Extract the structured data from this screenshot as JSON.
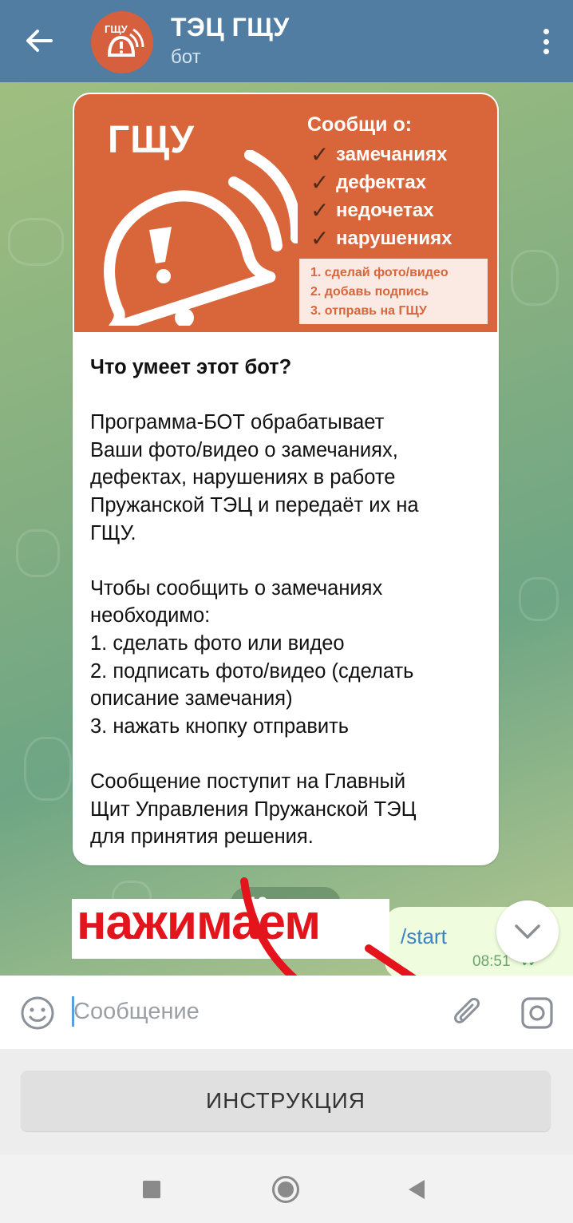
{
  "header": {
    "title": "ТЭЦ ГЩУ",
    "subtitle": "бот",
    "back_icon": "arrow-left-icon",
    "menu_icon": "more-vertical-icon",
    "avatar_text": "ГЩУ"
  },
  "banner": {
    "brand": "ГЩУ",
    "heading": "Сообщи о:",
    "items": [
      "замечаниях",
      "дефектах",
      "недочетах",
      "нарушениях"
    ],
    "steps": [
      "1. сделай фото/видео",
      "2. добавь подпись",
      "3. отправь на ГЩУ"
    ]
  },
  "message": {
    "title": "Что умеет этот бот?",
    "body": "Программа-БОТ обрабатывает\nВаши фото/видео о замечаниях,\nдефектах, нарушениях в работе\nПружанской ТЭЦ и передаёт их на\nГЩУ.\n\nЧтобы сообщить о замечаниях\nнеобходимо:\n1. сделать фото или видео\n2. подписать фото/видео (сделать\nописание замечания)\n3. нажать кнопку отправить\n\nСообщение поступит на Главный\nЩит Управления Пружанской ТЭЦ\nдля принятия решения."
  },
  "date_chip": "12 марта",
  "outgoing": {
    "text": "/start",
    "time": "08:51"
  },
  "annotation": {
    "text": "нажимаем",
    "color": "#e3141b"
  },
  "input": {
    "placeholder": "Сообщение",
    "emoji_icon": "smile-icon",
    "attach_icon": "paperclip-icon",
    "camera_icon": "camera-icon"
  },
  "keyboard": {
    "button_label": "ИНСТРУКЦИЯ"
  },
  "colors": {
    "header": "#517da2",
    "banner": "#d9653b",
    "outgoing_bubble": "#effdde"
  }
}
